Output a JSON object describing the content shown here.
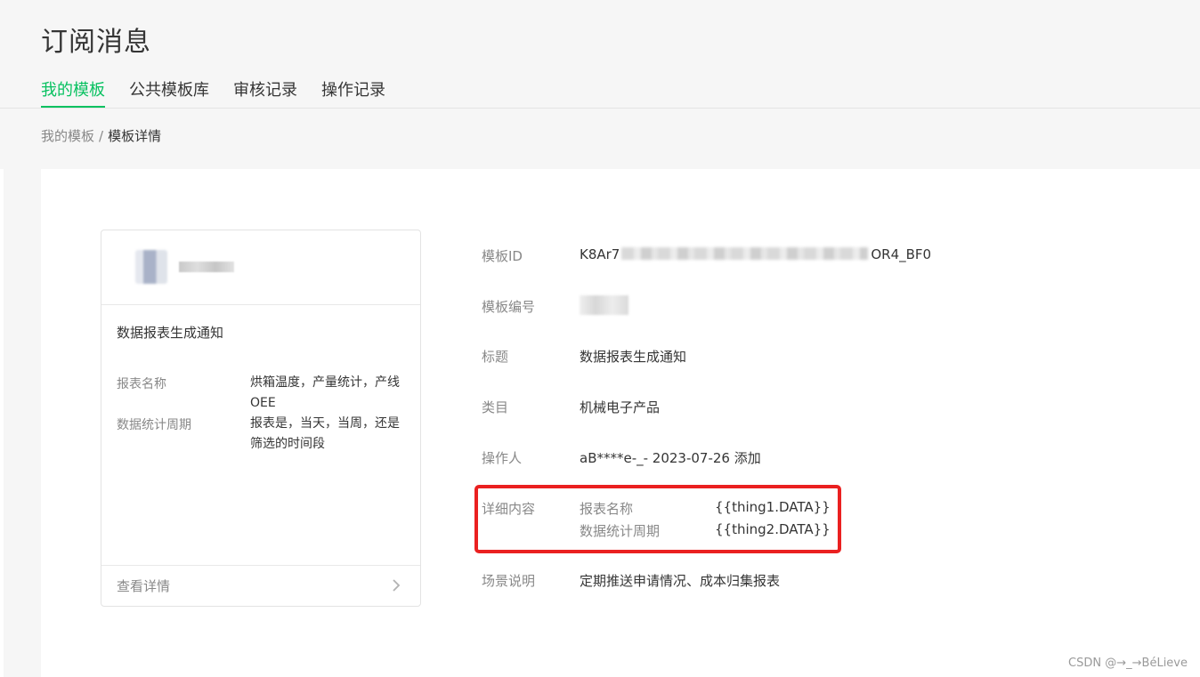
{
  "page_title": "订阅消息",
  "tabs": [
    {
      "label": "我的模板",
      "active": true
    },
    {
      "label": "公共模板库",
      "active": false
    },
    {
      "label": "审核记录",
      "active": false
    },
    {
      "label": "操作记录",
      "active": false
    }
  ],
  "breadcrumb": {
    "parent": "我的模板",
    "separator": "/",
    "current": "模板详情"
  },
  "preview_card": {
    "title": "数据报表生成通知",
    "fields": [
      {
        "label": "报表名称",
        "value": "烘箱温度，产量统计，产线OEE"
      },
      {
        "label": "数据统计周期",
        "value": "报表是，当天，当周，还是筛选的时间段"
      }
    ],
    "footer_link": "查看详情"
  },
  "details": {
    "template_id": {
      "label": "模板ID",
      "value_prefix": "K8Ar7",
      "value_suffix": "OR4_BF0"
    },
    "template_no": {
      "label": "模板编号"
    },
    "title": {
      "label": "标题",
      "value": "数据报表生成通知"
    },
    "category": {
      "label": "类目",
      "value": "机械电子产品"
    },
    "operator": {
      "label": "操作人",
      "value": "aB****e-_- 2023-07-26 添加"
    },
    "content": {
      "label": "详细内容",
      "rows": [
        {
          "key": "报表名称",
          "value": "{{thing1.DATA}}"
        },
        {
          "key": "数据统计周期",
          "value": "{{thing2.DATA}}"
        }
      ]
    },
    "scene": {
      "label": "场景说明",
      "value": "定期推送申请情况、成本归集报表"
    }
  },
  "watermark": "CSDN @→_→BéLieve",
  "colors": {
    "accent": "#07c160",
    "highlight": "#ea2020",
    "muted": "#888888"
  }
}
